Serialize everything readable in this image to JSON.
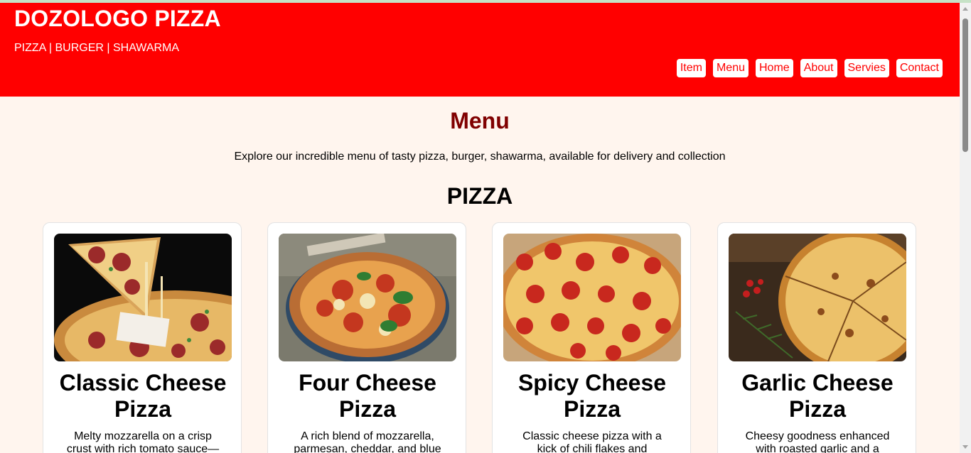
{
  "header": {
    "title": "DOZOLOGO PIZZA",
    "subtitle": "PIZZA | BURGER | SHAWARMA",
    "brand_color": "#ff0000"
  },
  "nav": {
    "items": [
      {
        "label": "Item"
      },
      {
        "label": "Menu"
      },
      {
        "label": "Home"
      },
      {
        "label": "About"
      },
      {
        "label": "Servies"
      },
      {
        "label": "Contact"
      }
    ]
  },
  "main": {
    "heading": "Menu",
    "intro": "Explore our incredible menu of tasty pizza, burger, shawarma, available for delivery and collection",
    "section_heading": "PIZZA",
    "cards": [
      {
        "title": "Classic Cheese Pizza",
        "description": "Melty mozzarella on a crisp crust with rich tomato sauce—"
      },
      {
        "title": "Four Cheese Pizza",
        "description": "A rich blend of mozzarella, parmesan, cheddar, and blue"
      },
      {
        "title": "Spicy Cheese Pizza",
        "description": "Classic cheese pizza with a kick of chili flakes and jalapeños for"
      },
      {
        "title": "Garlic Cheese Pizza",
        "description": "Cheesy goodness enhanced with roasted garlic and a buttery"
      }
    ]
  },
  "colors": {
    "page_background": "#fff5ee",
    "heading_color": "#800000"
  }
}
